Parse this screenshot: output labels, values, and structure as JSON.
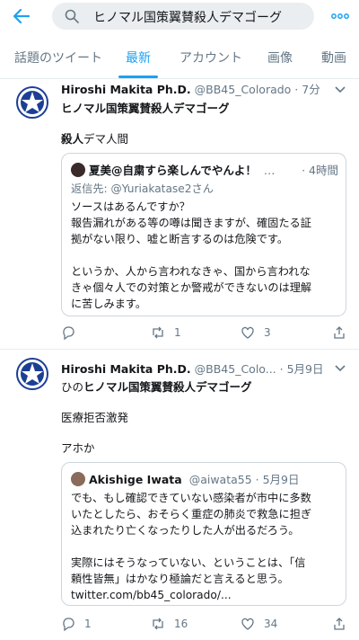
{
  "search": {
    "query": "ヒノマル国策翼賛殺人デマゴーグ"
  },
  "tabs": [
    {
      "label": "話題のツイート"
    },
    {
      "label": "最新"
    },
    {
      "label": "アカウント"
    },
    {
      "label": "画像"
    },
    {
      "label": "動画"
    }
  ],
  "tweets": [
    {
      "name": "Hiroshi Makita Ph.D.",
      "handle_time": "@BB45_Colorado · 7分",
      "line1": "ヒノマル国策翼賛殺人デマゴーグ",
      "body_bold": "殺人",
      "body_rest": "デマ人間",
      "quote": {
        "name": "夏美@自粛すら楽しんでやんよ！",
        "dots": "…",
        "time": "· 4時間",
        "reply_to": "返信先: @Yuriakatase2さん",
        "lines": [
          "ソースはあるんですか？",
          "報告漏れがある等の噂は聞きますが、確固たる証",
          "拠がない限り、嘘と断言するのは危険です。",
          "",
          "というか、人から言われなきゃ、国から言われな",
          "きゃ個々人での対策とか警戒ができないのは理解",
          "に苦しみます。"
        ]
      },
      "reply_count": "",
      "retweet_count": "1",
      "like_count": "3"
    },
    {
      "name": "Hiroshi Makita Ph.D.",
      "handle_time": "@BB45_Colo... · 5月9日",
      "line1_prefix": "ひの",
      "line1_bold": "ヒノマル国策翼賛殺人デマゴーグ",
      "body1": "医療拒否激発",
      "body2": "アホか",
      "quote": {
        "name": "Akishige Iwata",
        "handle_time": "@aiwata55 · 5月9日",
        "lines": [
          "でも、もし確認できていない感染者が市中に多数",
          "いたとしたら、おそらく重症の肺炎で救急に担ぎ",
          "込まれたり亡くなったりした人が出るだろう。",
          "",
          "実際にはそうなっていない、ということは、「信",
          "頼性皆無」はかなり極論だと言えると思う。",
          "twitter.com/bb45_colorado/..."
        ]
      },
      "reply_count": "1",
      "retweet_count": "16",
      "like_count": "34"
    }
  ],
  "colors": {
    "accent": "#1da1f2",
    "gray": "#657786",
    "divider": "#e6ecf0"
  }
}
